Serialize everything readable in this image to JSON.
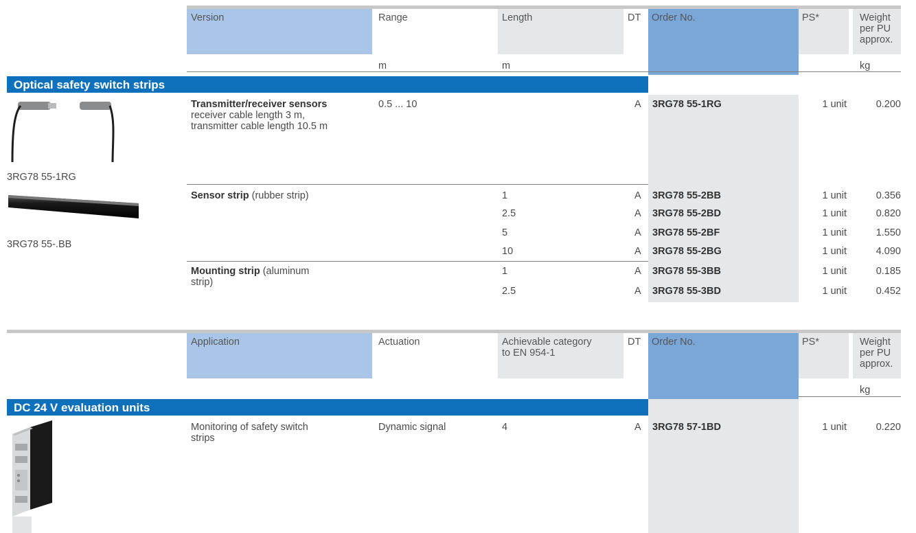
{
  "table1": {
    "headers": {
      "version": "Version",
      "range": "Range",
      "length": "Length",
      "dt": "DT",
      "order_no": "Order No.",
      "ps": "PS*",
      "weight_l1": "Weight",
      "weight_l2": "per PU",
      "weight_l3": "approx."
    },
    "units": {
      "range": "m",
      "length": "m",
      "weight": "kg"
    },
    "section_title": "Optical safety switch strips",
    "image1_label": "3RG78 55-1RG",
    "image2_label": "3RG78 55-.BB",
    "group1": {
      "title": "Transmitter/receiver sensors",
      "line2": "receiver cable length 3 m,",
      "line3": "transmitter cable length 10.5 m",
      "range": "0.5 ... 10",
      "dt": "A",
      "order": "3RG78 55-1RG",
      "ps": "1 unit",
      "weight": "0.200"
    },
    "group2": {
      "title": "Sensor strip",
      "suffix": " (rubber strip)",
      "rows": [
        {
          "length": "1",
          "dt": "A",
          "order": "3RG78 55-2BB",
          "ps": "1 unit",
          "weight": "0.356"
        },
        {
          "length": "2.5",
          "dt": "A",
          "order": "3RG78 55-2BD",
          "ps": "1 unit",
          "weight": "0.820"
        },
        {
          "length": "5",
          "dt": "A",
          "order": "3RG78 55-2BF",
          "ps": "1 unit",
          "weight": "1.550"
        },
        {
          "length": "10",
          "dt": "A",
          "order": "3RG78 55-2BG",
          "ps": "1 unit",
          "weight": "4.090"
        }
      ]
    },
    "group3": {
      "title": "Mounting strip",
      "suffix": " (aluminum",
      "line2": "strip)",
      "rows": [
        {
          "length": "1",
          "dt": "A",
          "order": "3RG78 55-3BB",
          "ps": "1 unit",
          "weight": "0.185"
        },
        {
          "length": "2.5",
          "dt": "A",
          "order": "3RG78 55-3BD",
          "ps": "1 unit",
          "weight": "0.452"
        }
      ]
    }
  },
  "table2": {
    "headers": {
      "application": "Application",
      "actuation": "Actuation",
      "category_l1": "Achievable category",
      "category_l2": "to EN 954-1",
      "dt": "DT",
      "order_no": "Order No.",
      "ps": "PS*",
      "weight_l1": "Weight",
      "weight_l2": "per PU",
      "weight_l3": "approx."
    },
    "units": {
      "weight": "kg"
    },
    "section_title": "DC 24 V evaluation units",
    "row": {
      "application_l1": "Monitoring of safety switch",
      "application_l2": "strips",
      "actuation": "Dynamic signal",
      "category": "4",
      "dt": "A",
      "order": "3RG78 57-1BD",
      "ps": "1 unit",
      "weight": "0.220"
    }
  }
}
